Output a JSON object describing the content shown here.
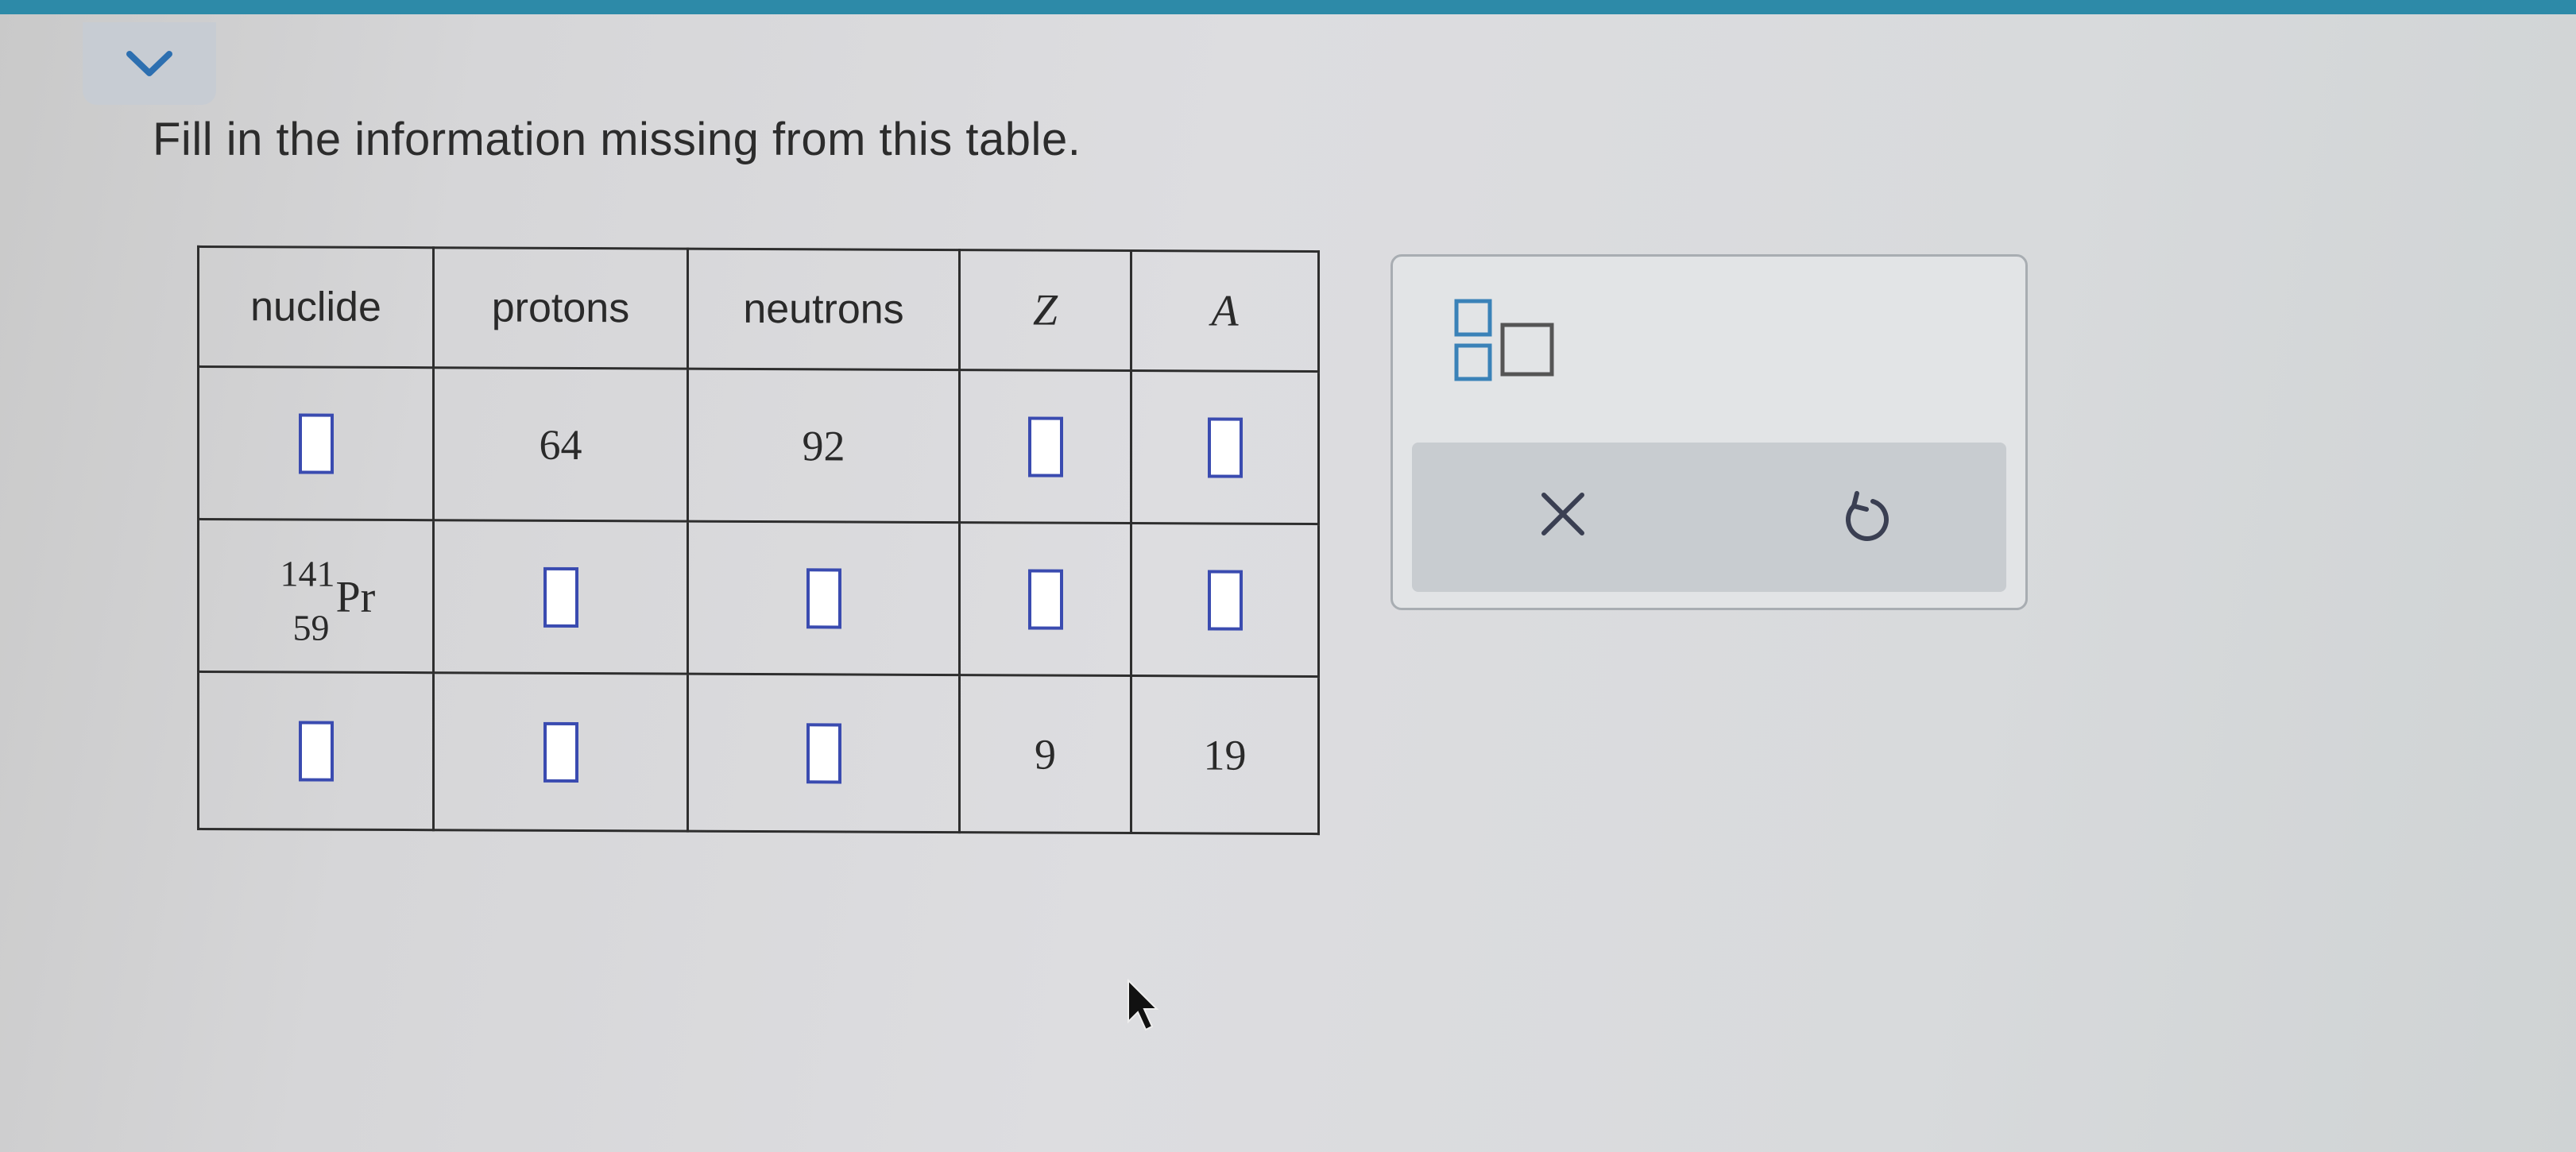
{
  "question": {
    "prompt": "Fill in the information missing from this table."
  },
  "table": {
    "headers": [
      "nuclide",
      "protons",
      "neutrons",
      "Z",
      "A"
    ],
    "rows": [
      {
        "nuclide": null,
        "protons": "64",
        "neutrons": "92",
        "Z": null,
        "A": null
      },
      {
        "nuclide": {
          "mass_number": "141",
          "atomic_number": "59",
          "symbol": "Pr"
        },
        "protons": null,
        "neutrons": null,
        "Z": null,
        "A": null
      },
      {
        "nuclide": null,
        "protons": null,
        "neutrons": null,
        "Z": "9",
        "A": "19"
      }
    ]
  },
  "tool_panel": {
    "tools": [
      "fraction-template-icon",
      "box-template-icon"
    ],
    "actions": [
      "clear-icon",
      "undo-icon"
    ]
  },
  "colors": {
    "accent_bar": "#2d8aa8",
    "answer_box_border": "#3a4bb0",
    "collapse_chevron": "#2d6fb0"
  }
}
